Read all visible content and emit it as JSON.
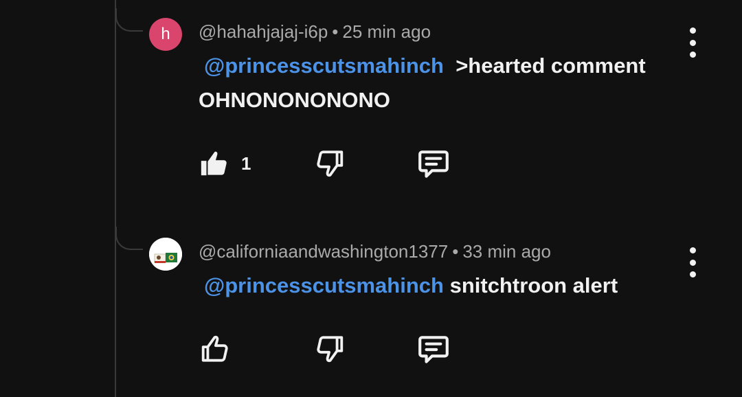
{
  "comments": [
    {
      "avatar_letter": "h",
      "avatar_color": "#d9456d",
      "author": "@hahahjajaj-i6p",
      "separator": "•",
      "time": "25 min ago",
      "mention": "@princesscutsmahinch",
      "text_after_mention": ">hearted comment",
      "text_line2": "OHNONONONONO",
      "like_count": "1",
      "liked": true
    },
    {
      "avatar_color": "#ffffff",
      "author": "@californiaandwashington1377",
      "separator": "•",
      "time": "33 min ago",
      "mention": "@princesscutsmahinch",
      "text_after_mention": "snitchtroon alert",
      "liked": false
    }
  ],
  "icons": {
    "like": "thumbs-up-icon",
    "dislike": "thumbs-down-icon",
    "reply": "reply-icon",
    "menu": "more-vert-icon"
  }
}
